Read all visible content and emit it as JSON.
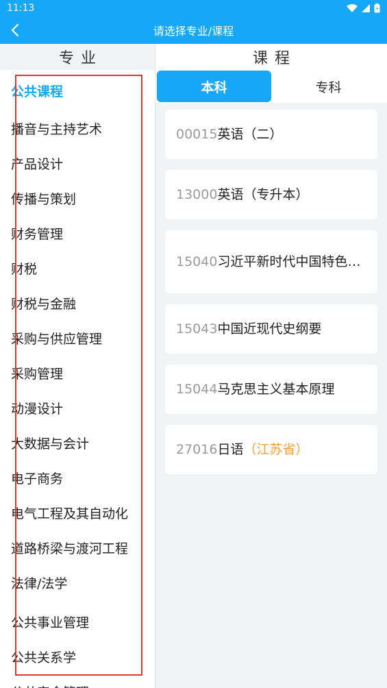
{
  "status_bar": {
    "time": "11:13",
    "icons": [
      "wifi-icon",
      "signal-icon",
      "battery-icon"
    ]
  },
  "header": {
    "title": "请选择专业/课程",
    "back_icon": "chevron-left-icon"
  },
  "left": {
    "title": "专业",
    "majors": [
      "公共课程",
      "播音与主持艺术",
      "产品设计",
      "传播与策划",
      "财务管理",
      "财税",
      "财税与金融",
      "采购与供应管理",
      "采购管理",
      "动漫设计",
      "大数据与会计",
      "电子商务",
      "电气工程及其自动化",
      "道路桥梁与渡河工程",
      "法律/法学",
      "公共事业管理",
      "公共关系学",
      "公共安全管理"
    ]
  },
  "right": {
    "title": "课程",
    "tabs": [
      "本科",
      "专科"
    ],
    "courses": [
      {
        "code": "00015",
        "name": "英语（二）",
        "note": ""
      },
      {
        "code": "13000",
        "name": "英语（专升本）",
        "note": ""
      },
      {
        "code": "15040",
        "name": "习近平新时代中国特色…",
        "note": ""
      },
      {
        "code": "15043",
        "name": "中国近现代史纲要",
        "note": ""
      },
      {
        "code": "15044",
        "name": "马克思主义基本原理",
        "note": ""
      },
      {
        "code": "27016",
        "name": "日语",
        "note": "（江苏省）"
      }
    ]
  },
  "colors": {
    "accent": "#16a8f6",
    "highlight_box": "#e4312b",
    "note": "#f0a033",
    "code": "#9a9a9a"
  }
}
